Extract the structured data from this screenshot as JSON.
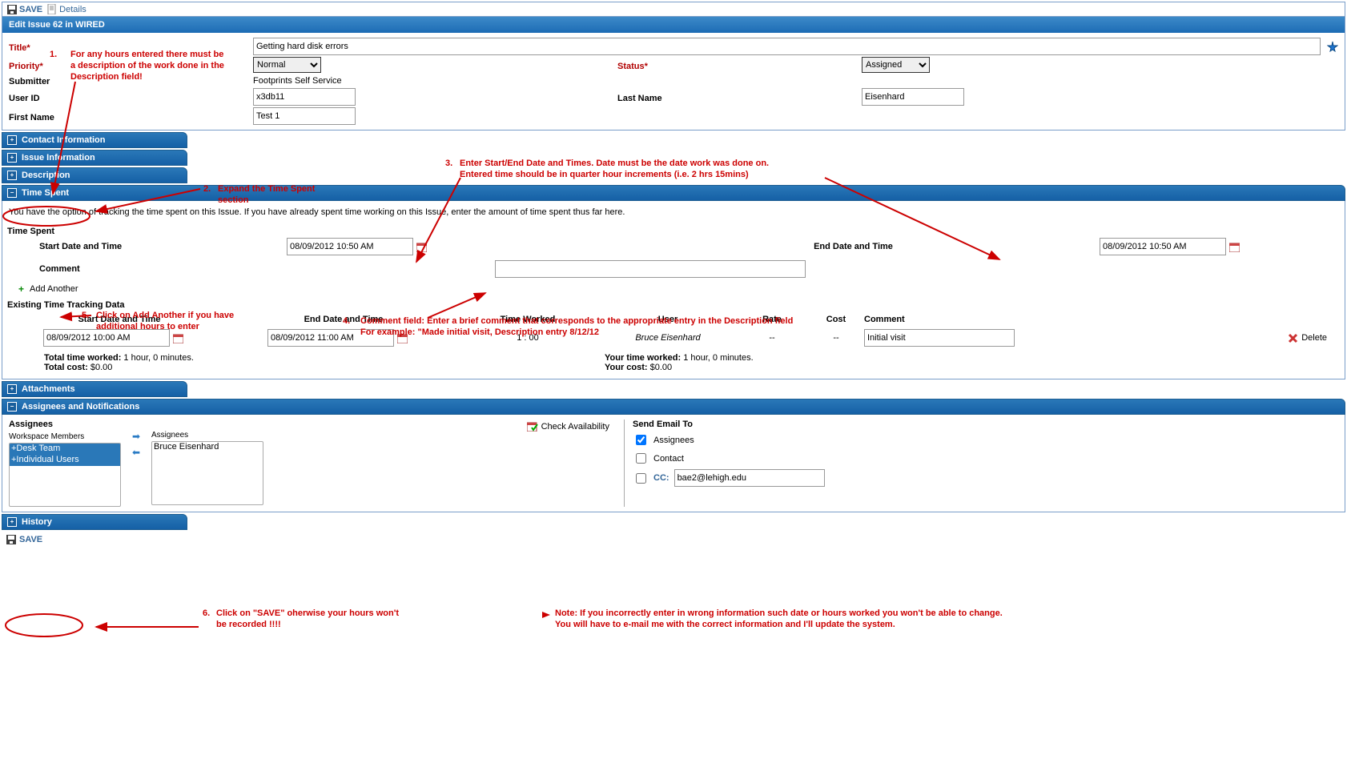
{
  "toolbar": {
    "save": "SAVE",
    "details": "Details"
  },
  "header": {
    "title": "Edit Issue 62 in WIRED"
  },
  "form": {
    "titleLabel": "Title*",
    "titleValue": "Getting hard disk errors",
    "priorityLabel": "Priority*",
    "priorityValue": "Normal",
    "statusLabel": "Status*",
    "statusValue": "Assigned",
    "submitterLabel": "Submitter",
    "submitterValue": "Footprints Self Service",
    "userIdLabel": "User ID",
    "userIdValue": "x3db11",
    "lastNameLabel": "Last Name",
    "lastNameValue": "Eisenhard",
    "firstNameLabel": "First Name",
    "firstNameValue": "Test 1"
  },
  "sections": {
    "contact": "Contact Information",
    "issue": "Issue Information",
    "description": "Description",
    "timeSpent": "Time Spent",
    "attachments": "Attachments",
    "assignees": "Assignees and Notifications",
    "history": "History"
  },
  "timeSpent": {
    "intro": "You have the option of tracking the time spent on this Issue. If you have already spent time working on this Issue, enter the amount of time spent thus far here.",
    "heading": "Time Spent",
    "startHead": "Start Date and Time",
    "endHead": "End Date and Time",
    "commentLabel": "Comment",
    "startValue": "08/09/2012 10:50 AM",
    "endValue": "08/09/2012 10:50 AM",
    "commentValue": "",
    "addAnother": "Add Another",
    "existingHead": "Existing Time Tracking Data",
    "cols": {
      "start": "Start Date and Time",
      "end": "End Date and Time",
      "tw": "Time Worked",
      "user": "User",
      "rate": "Rate",
      "cost": "Cost",
      "comment": "Comment"
    },
    "row": {
      "start": "08/09/2012 10:00 AM",
      "end": "08/09/2012 11:00 AM",
      "tw": "1 : 00",
      "user": "Bruce Eisenhard",
      "rate": "--",
      "cost": "--",
      "comment": "Initial visit",
      "delete": "Delete"
    },
    "totals": {
      "ttwLabel": "Total time worked:",
      "ttwValue": " 1 hour, 0 minutes.",
      "tcLabel": "Total cost:",
      "tcValue": " $0.00",
      "ytwLabel": "Your time worked:",
      "ytwValue": " 1 hour, 0 minutes.",
      "ycLabel": "Your cost:",
      "ycValue": " $0.00"
    }
  },
  "assignees": {
    "title": "Assignees",
    "wsm": "Workspace Members",
    "assignCol": "Assignees",
    "options": [
      "+Desk Team",
      "+Individual Users"
    ],
    "member": "Bruce Eisenhard",
    "checkAvail": "Check Availability",
    "sendTo": "Send Email To",
    "cbAssignees": "Assignees",
    "cbContact": "Contact",
    "ccLabel": "CC:",
    "ccValue": "bae2@lehigh.edu"
  },
  "bottom": {
    "save": "SAVE"
  },
  "anno": {
    "n1": "1.",
    "t1a": "For any hours entered there must be",
    "t1b": "a description of the work done in the",
    "t1c": "Description field!",
    "n2": "2.",
    "t2a": "Expand the Time Spent",
    "t2b": "section",
    "n3": "3.",
    "t3a": "Enter Start/End Date and Times.  Date must be the date work was done on.",
    "t3b": "Entered time should be in quarter hour increments (i.e. 2 hrs 15mins)",
    "n4": "4.",
    "t4a": "Comment field: Enter a brief comment that corresponds to the appropriate entry in the Description field",
    "t4b": "For example:  \"Made initial visit,  Description entry 8/12/12",
    "n5": "5.",
    "t5a": "Click on Add Another if you have",
    "t5b": "additional hours to enter",
    "n6": "6.",
    "t6a": "Click on \"SAVE\" oherwise your hours won't",
    "t6b": "be recorded !!!!",
    "note": "Note:  If you incorrectly enter in wrong information such date or hours worked you won't be able to change.",
    "note2": "You will have to e-mail me with the correct information and I'll update the system."
  }
}
